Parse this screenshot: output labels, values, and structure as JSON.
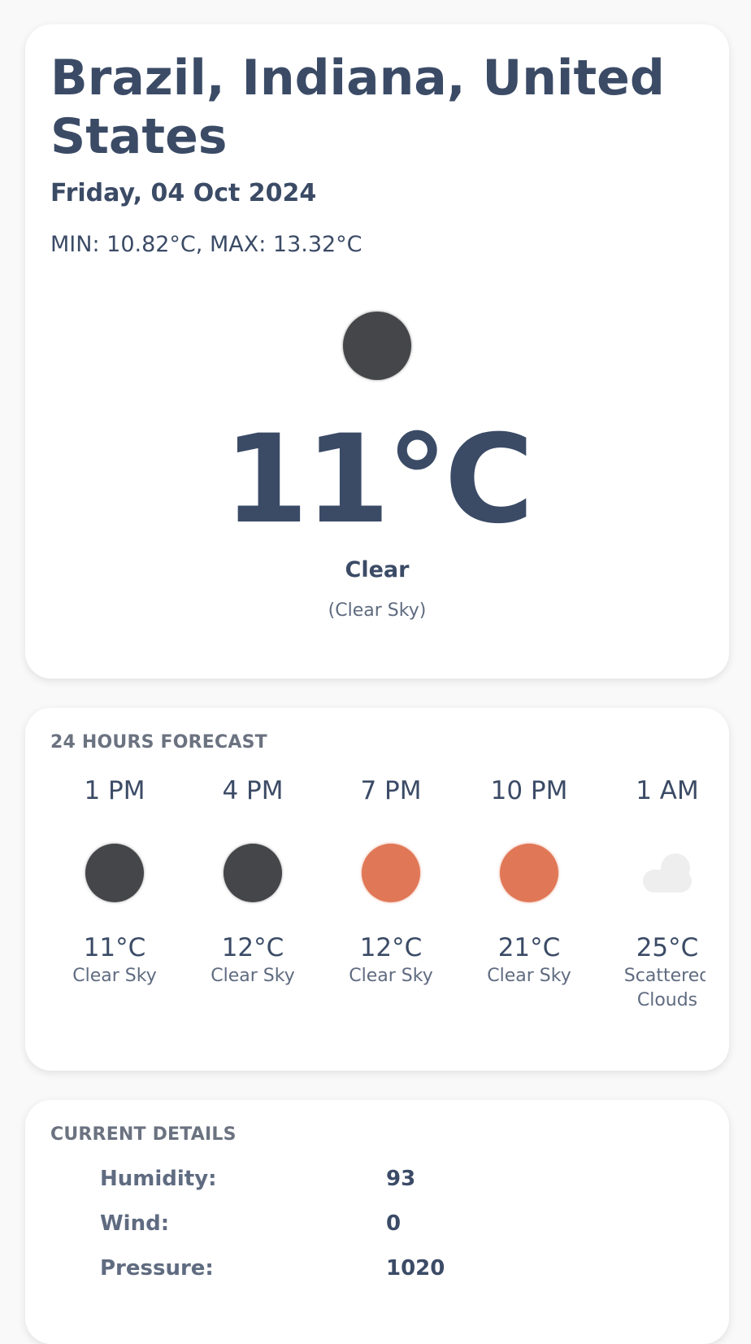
{
  "current": {
    "location": "Brazil, Indiana, United States",
    "date": "Friday, 04 Oct 2024",
    "minmax": "MIN: 10.82°C, MAX: 13.32°C",
    "temperature": "11°C",
    "condition": "Clear",
    "condition_detail": "(Clear Sky)",
    "icon": "clear-night-icon"
  },
  "forecast": {
    "title": "24 HOURS FORECAST",
    "hours": [
      {
        "time": "1 PM",
        "temp": "11°C",
        "desc": "Clear Sky",
        "icon": "clear-night-icon"
      },
      {
        "time": "4 PM",
        "temp": "12°C",
        "desc": "Clear Sky",
        "icon": "clear-night-icon"
      },
      {
        "time": "7 PM",
        "temp": "12°C",
        "desc": "Clear Sky",
        "icon": "sun-icon"
      },
      {
        "time": "10 PM",
        "temp": "21°C",
        "desc": "Clear Sky",
        "icon": "sun-icon"
      },
      {
        "time": "1 AM",
        "temp": "25°C",
        "desc": "Scattered Clouds",
        "icon": "cloud-icon"
      }
    ]
  },
  "details": {
    "title": "CURRENT DETAILS",
    "rows": [
      {
        "label": "Humidity:",
        "value": "93"
      },
      {
        "label": "Wind:",
        "value": "0"
      },
      {
        "label": "Pressure:",
        "value": "1020"
      }
    ]
  },
  "colors": {
    "text": "#3b4b66",
    "muted": "#6b7280",
    "night_icon": "#454649",
    "sun_icon": "#e07756",
    "cloud_icon": "#eeeeee"
  }
}
